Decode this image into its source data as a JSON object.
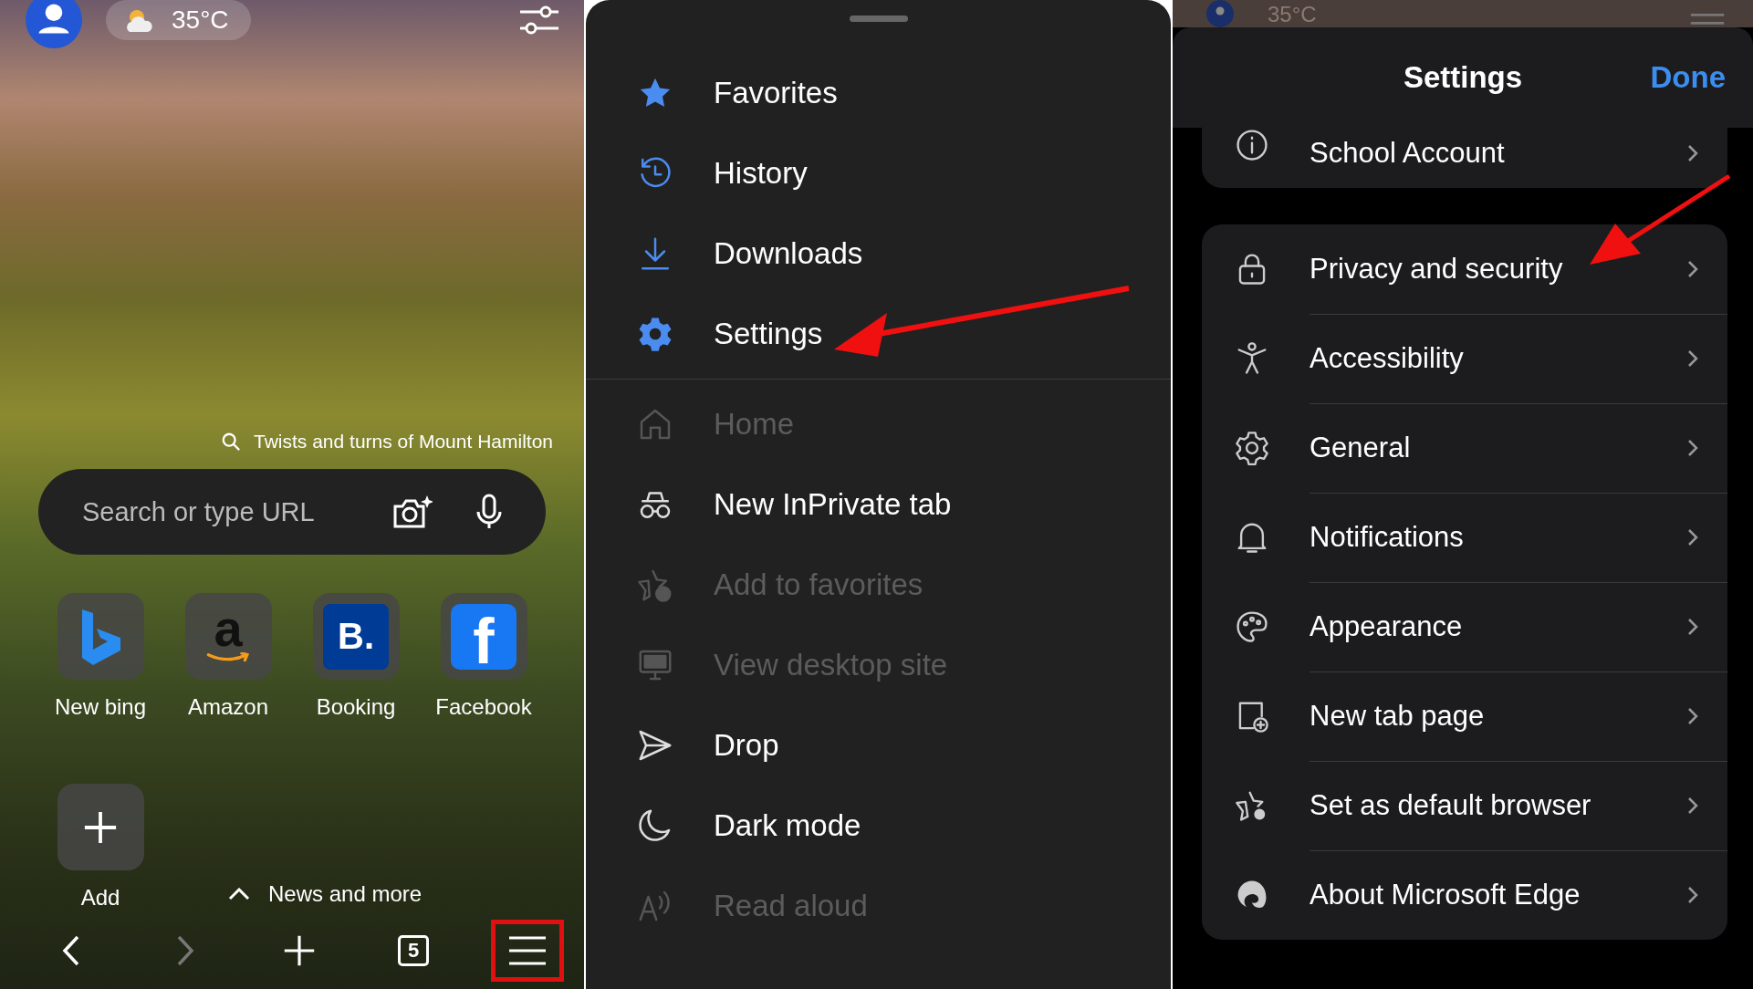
{
  "home": {
    "weather": "35°C",
    "caption": "Twists and turns of Mount Hamilton",
    "search": {
      "placeholder": "Search or type URL"
    },
    "tiles": [
      {
        "kind": "bing",
        "label": "New bing"
      },
      {
        "kind": "amazon",
        "glyph": "a",
        "label": "Amazon"
      },
      {
        "kind": "booking",
        "glyph": "B.",
        "label": "Booking"
      },
      {
        "kind": "facebook",
        "glyph": "f",
        "label": "Facebook"
      },
      {
        "kind": "add",
        "label": "Add"
      }
    ],
    "news": "News and more",
    "toolbar": [
      {
        "kind": "back",
        "disabled": false
      },
      {
        "kind": "forward",
        "disabled": true
      },
      {
        "kind": "plus",
        "disabled": false
      },
      {
        "kind": "tabs",
        "label": "5",
        "disabled": false
      },
      {
        "kind": "menu",
        "disabled": false,
        "highlighted": true
      }
    ]
  },
  "menu": {
    "sections": [
      {
        "items": [
          {
            "label": "Favorites",
            "disabled": false
          },
          {
            "label": "History",
            "disabled": false
          },
          {
            "label": "Downloads",
            "disabled": false
          },
          {
            "label": "Settings",
            "disabled": false
          }
        ]
      },
      {
        "items": [
          {
            "label": "Home",
            "disabled": true
          },
          {
            "label": "New InPrivate tab",
            "disabled": false
          },
          {
            "label": "Add to favorites",
            "disabled": true
          },
          {
            "label": "View desktop site",
            "disabled": true
          },
          {
            "label": "Drop",
            "disabled": false
          },
          {
            "label": "Dark mode",
            "disabled": false
          },
          {
            "label": "Read aloud",
            "disabled": true
          }
        ]
      }
    ]
  },
  "settings": {
    "behind_weather": "35°C",
    "title": "Settings",
    "done": "Done",
    "groups": [
      {
        "items": [
          {
            "label": "School Account"
          }
        ]
      },
      {
        "items": [
          {
            "label": "Privacy and security"
          },
          {
            "label": "Accessibility"
          },
          {
            "label": "General"
          },
          {
            "label": "Notifications"
          },
          {
            "label": "Appearance"
          },
          {
            "label": "New tab page"
          },
          {
            "label": "Set as default browser"
          },
          {
            "label": "About Microsoft Edge"
          }
        ]
      }
    ]
  }
}
